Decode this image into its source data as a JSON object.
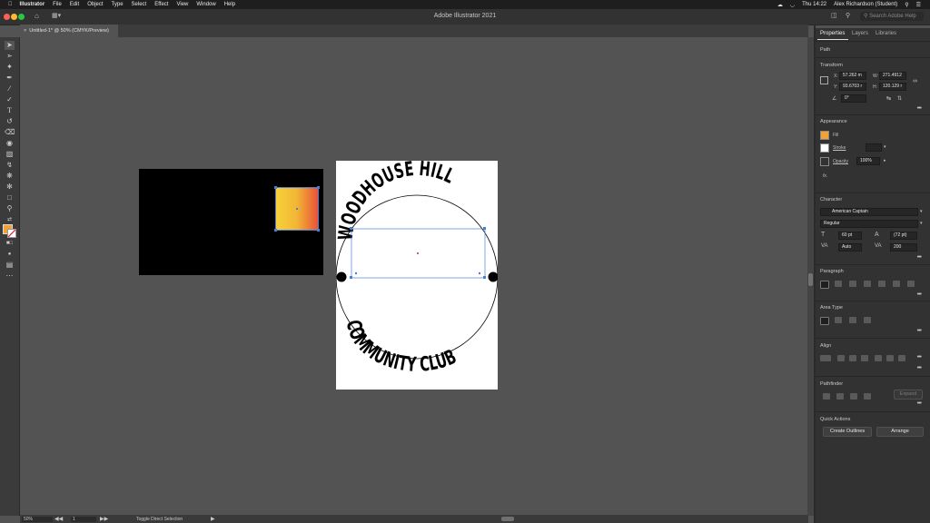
{
  "menubar": {
    "app_name": "Illustrator",
    "items": [
      "File",
      "Edit",
      "Object",
      "Type",
      "Select",
      "Effect",
      "View",
      "Window",
      "Help"
    ],
    "clock": "Thu 14:22",
    "user": "Alex Richardson (Student)"
  },
  "titlebar": {
    "title": "Adobe Illustrator 2021",
    "search_placeholder": "Search Adobe Help"
  },
  "document_tab": {
    "label": "Untitled-1* @ 50% (CMYK/Preview)"
  },
  "artwork": {
    "top_text": "WOODHOUSE HILL",
    "bottom_text": "COMMUNITY CLUB",
    "gradient": [
      "#f6d23a",
      "#e8523a"
    ]
  },
  "statusbar": {
    "zoom": "50%",
    "artboard": "1",
    "tool_hint": "Toggle Direct Selection"
  },
  "panel": {
    "tabs": [
      "Properties",
      "Layers",
      "Libraries"
    ],
    "selection_type": "Path",
    "transform": {
      "title": "Transform",
      "x_label": "X:",
      "x": "57.262 m",
      "y_label": "Y:",
      "y": "93.6703 r",
      "w_label": "W:",
      "w": "271.4912",
      "h_label": "H:",
      "h": "120.129 r",
      "angle": "0°"
    },
    "appearance": {
      "title": "Appearance",
      "fill": "Fill",
      "stroke": "Stroke",
      "opacity_label": "Opacity",
      "opacity": "100%",
      "fx": "fx."
    },
    "character": {
      "title": "Character",
      "font": "American Captain",
      "style": "Regular",
      "size": "60 pt",
      "leading": "(72 pt)",
      "kerning": "Auto",
      "tracking": "200"
    },
    "paragraph": {
      "title": "Paragraph"
    },
    "area_type": {
      "title": "Area Type"
    },
    "align": {
      "title": "Align"
    },
    "pathfinder": {
      "title": "Pathfinder",
      "expand": "Expand"
    },
    "quick_actions": {
      "title": "Quick Actions",
      "create_outlines": "Create Outlines",
      "arrange": "Arrange"
    }
  },
  "colors": {
    "accent": "#4a7fd6",
    "fill_swatch": "#f2a234"
  }
}
